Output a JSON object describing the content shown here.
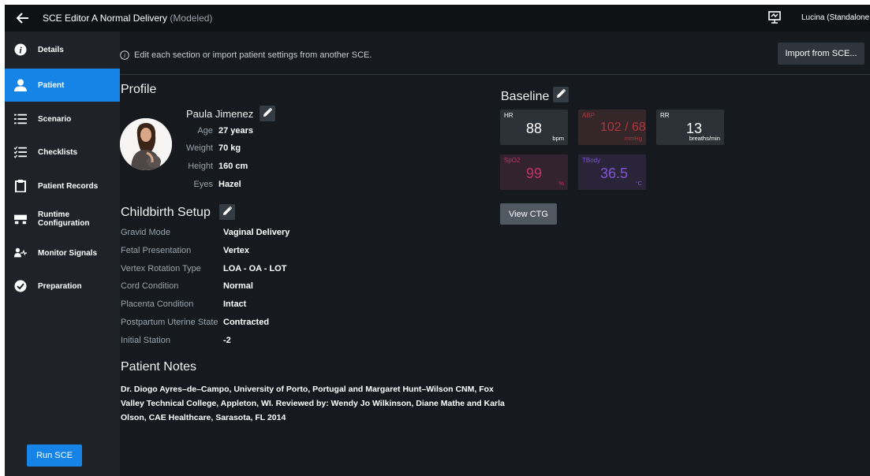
{
  "titlebar": {
    "app": "SCE Editor",
    "scenario": "A Normal Delivery",
    "tag": "(Modeled)",
    "user": "Lucina (Standalone"
  },
  "sidebar": {
    "items": [
      {
        "label": "Details",
        "icon": "info-icon"
      },
      {
        "label": "Patient",
        "icon": "person-icon"
      },
      {
        "label": "Scenario",
        "icon": "list-icon"
      },
      {
        "label": "Checklists",
        "icon": "checklist-icon"
      },
      {
        "label": "Patient Records",
        "icon": "clipboard-icon"
      },
      {
        "label": "Runtime Configuration",
        "icon": "runtime-icon"
      },
      {
        "label": "Monitor Signals",
        "icon": "monitor-signals-icon"
      },
      {
        "label": "Preparation",
        "icon": "check-circle-icon"
      }
    ],
    "active_index": 1,
    "run_button": "Run SCE"
  },
  "info": {
    "text": "Edit each section or import patient settings from another SCE.",
    "import_button": "Import from SCE..."
  },
  "profile": {
    "heading": "Profile",
    "name": "Paula Jimenez",
    "rows": [
      {
        "key": "Age",
        "value": "27 years"
      },
      {
        "key": "Weight",
        "value": "70 kg"
      },
      {
        "key": "Height",
        "value": "160 cm"
      },
      {
        "key": "Eyes",
        "value": "Hazel"
      }
    ]
  },
  "childbirth": {
    "heading": "Childbirth Setup",
    "rows": [
      {
        "key": "Gravid Mode",
        "value": "Vaginal Delivery"
      },
      {
        "key": "Fetal Presentation",
        "value": "Vertex"
      },
      {
        "key": "Vertex Rotation Type",
        "value": "LOA - OA - LOT"
      },
      {
        "key": "Cord Condition",
        "value": "Normal"
      },
      {
        "key": "Placenta Condition",
        "value": "Intact"
      },
      {
        "key": "Postpartum Uterine State",
        "value": "Contracted"
      },
      {
        "key": "Initial Station",
        "value": "-2"
      }
    ]
  },
  "notes": {
    "heading": "Patient Notes",
    "text": "Dr. Diogo Ayres–de–Campo, University of Porto, Portugal and Margaret Hunt–Wilson CNM, Fox Valley Technical College, Appleton, WI. Reviewed by: Wendy Jo Wilkinson, Diane Mathe and Karla Olson, CAE Healthcare, Sarasota, FL 2014"
  },
  "baseline": {
    "heading": "Baseline",
    "vitals": [
      {
        "label": "HR",
        "value": "88",
        "unit": "bpm",
        "color": "#ffffff",
        "bg": "#2b3137"
      },
      {
        "label": "ABP",
        "value": "102 / 68",
        "unit": "mmHg",
        "color": "#b0353c",
        "bg": "#35262a"
      },
      {
        "label": "RR",
        "value": "13",
        "unit": "breaths/min",
        "color": "#ffffff",
        "bg": "#2b3137"
      },
      {
        "label": "SpO2",
        "value": "99",
        "unit": "%",
        "color": "#c0326e",
        "bg": "#33222f"
      },
      {
        "label": "TBody",
        "value": "36.5",
        "unit": "°C",
        "color": "#7e55d6",
        "bg": "#2a2438"
      }
    ],
    "ctg_button": "View CTG"
  },
  "colors": {
    "accent": "#1683e6",
    "background": "#16191d",
    "sidebar": "#1f2328"
  }
}
